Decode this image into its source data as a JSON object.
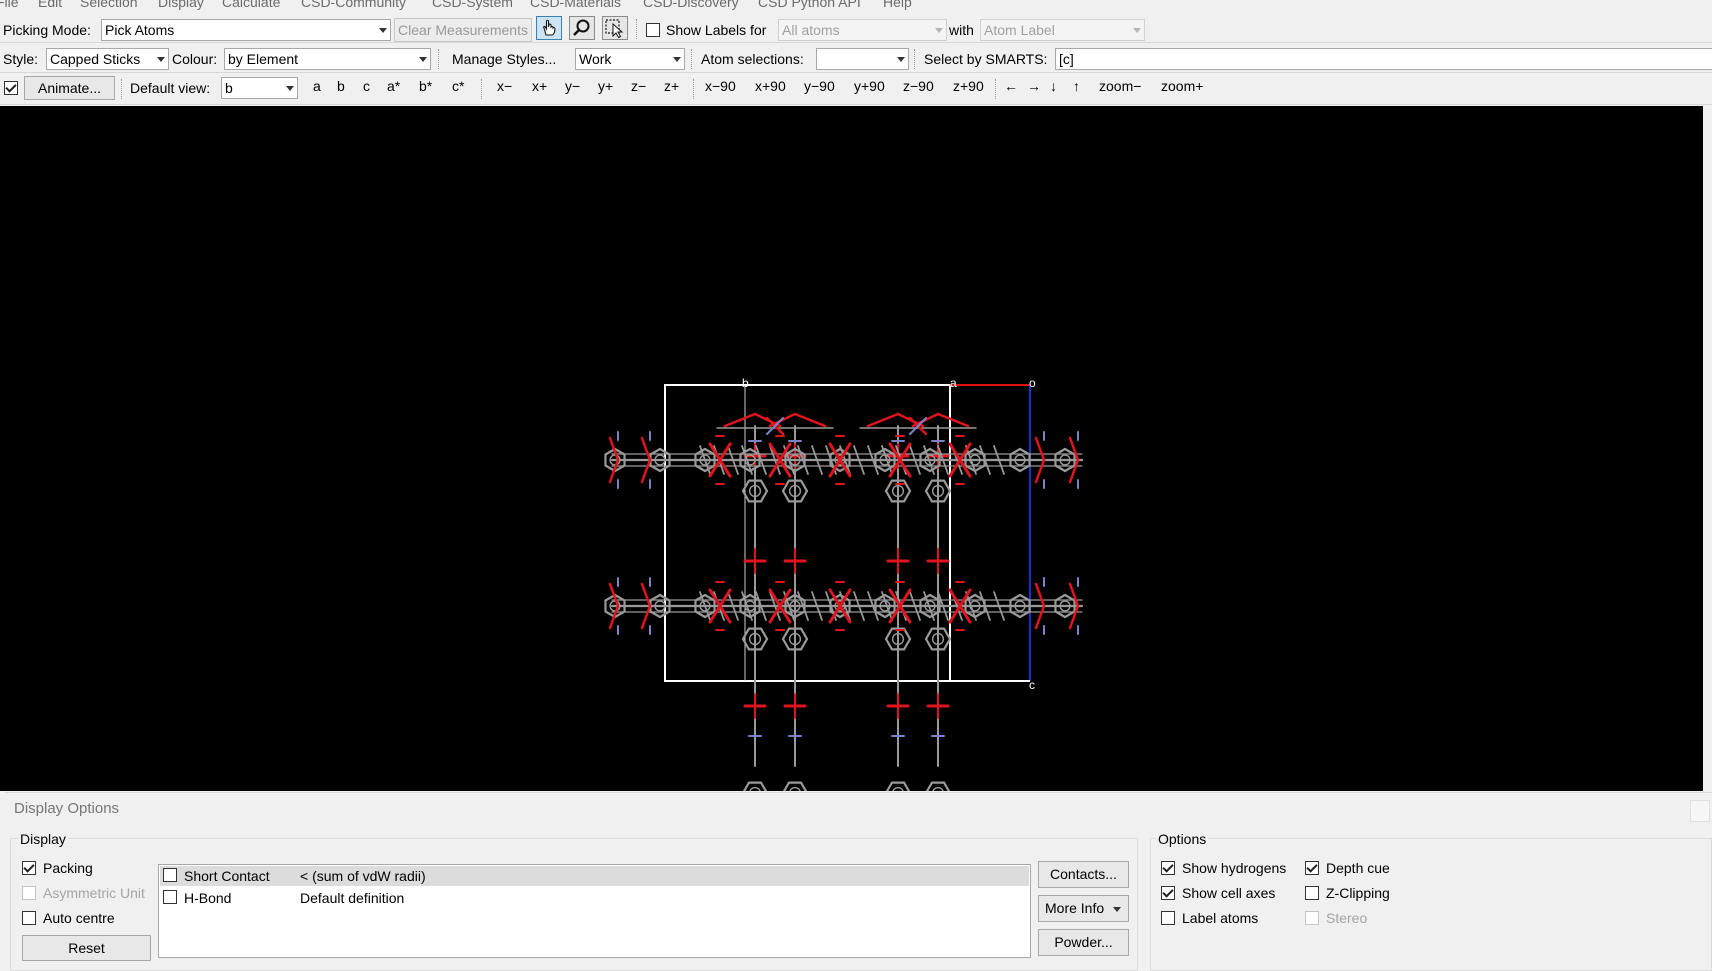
{
  "menu": [
    "File",
    "Edit",
    "Selection",
    "Display",
    "Calculate",
    "CSD-Community",
    "CSD-System",
    "CSD-Materials",
    "CSD-Discovery",
    "CSD Python API",
    "Help"
  ],
  "toolbar1": {
    "picking_mode_label": "Picking Mode:",
    "picking_mode_value": "Pick Atoms",
    "clear_measurements": "Clear Measurements",
    "show_labels_label": "Show Labels for",
    "show_labels_value": "All atoms",
    "with_label": "with",
    "label_type_value": "Atom Label"
  },
  "toolbar2": {
    "style_label": "Style:",
    "style_value": "Capped Sticks",
    "colour_label": "Colour:",
    "colour_value": "by Element",
    "manage_styles": "Manage Styles...",
    "work_value": "Work",
    "atom_selections_label": "Atom selections:",
    "atom_selections_value": "",
    "smarts_label": "Select by SMARTS:",
    "smarts_value": "[c]"
  },
  "toolbar3": {
    "animate_checked": true,
    "animate_button": "Animate...",
    "default_view_label": "Default view:",
    "default_view_value": "b",
    "views": [
      "a",
      "b",
      "c",
      "a*",
      "b*",
      "c*"
    ],
    "rotations": [
      "x−",
      "x+",
      "y−",
      "y+",
      "z−",
      "z+"
    ],
    "rotations90": [
      "x−90",
      "x+90",
      "y−90",
      "y+90",
      "z−90",
      "z+90"
    ],
    "arrows": [
      "←",
      "→",
      "↓",
      "↑"
    ],
    "zoom": [
      "zoom−",
      "zoom+"
    ]
  },
  "viewer": {
    "axis_labels": {
      "b": "b",
      "a": "a",
      "o": "o",
      "c": "c"
    },
    "colors": {
      "background": "#000000",
      "oxygen": "#e0141e",
      "carbon": "#9a9a9a",
      "nitrogen": "#7d82c8",
      "cell": "#ffffff",
      "axis_a": "#e01010",
      "axis_c": "#1830d0"
    }
  },
  "display_options": {
    "title": "Display Options",
    "display_group": "Display",
    "packing": {
      "label": "Packing",
      "checked": true
    },
    "asymmetric_unit": {
      "label": "Asymmetric Unit",
      "checked": false,
      "disabled": true
    },
    "auto_centre": {
      "label": "Auto centre",
      "checked": false
    },
    "reset": "Reset",
    "contacts": [
      {
        "name": "Short Contact",
        "definition": "< (sum of vdW radii)",
        "checked": false
      },
      {
        "name": "H-Bond",
        "definition": "Default definition",
        "checked": false
      }
    ],
    "contacts_button": "Contacts...",
    "more_info_button": "More Info",
    "powder_button": "Powder...",
    "options_group": "Options",
    "show_hydrogens": {
      "label": "Show hydrogens",
      "checked": true
    },
    "show_cell_axes": {
      "label": "Show cell axes",
      "checked": true
    },
    "label_atoms": {
      "label": "Label atoms",
      "checked": false
    },
    "depth_cue": {
      "label": "Depth cue",
      "checked": true
    },
    "z_clipping": {
      "label": "Z-Clipping",
      "checked": false
    },
    "stereo": {
      "label": "Stereo",
      "checked": false,
      "disabled": true
    }
  }
}
